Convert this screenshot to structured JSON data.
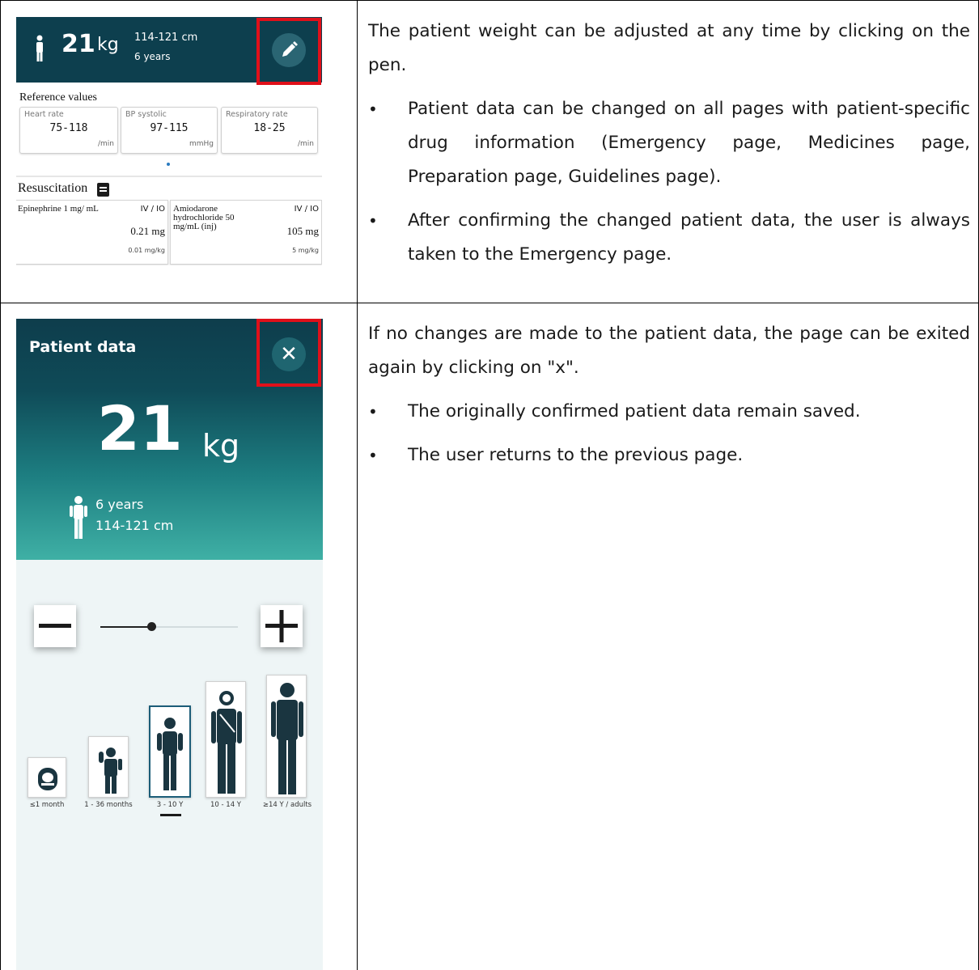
{
  "section1": {
    "screenshot": {
      "weight_value": "21",
      "weight_unit": "kg",
      "height_range": "114-121 cm",
      "age": "6 years",
      "edit_icon": "pencil-icon",
      "reference_title": "Reference values",
      "reference_values": [
        {
          "label": "Heart rate",
          "value": "75-118",
          "unit": "/min"
        },
        {
          "label": "BP systolic",
          "value": "97-115",
          "unit": "mmHg"
        },
        {
          "label": "Respiratory rate",
          "value": "18-25",
          "unit": "/min"
        }
      ],
      "resuscitation_title": "Resuscitation",
      "resuscitation_items": [
        {
          "name": "Epinephrine 1 mg/ mL",
          "route": "IV / IO",
          "dose": "0.21 mg",
          "per_kg": "0.01 mg/kg"
        },
        {
          "name": "Amiodarone hydrochloride 50 mg/mL (inj)",
          "route": "IV / IO",
          "dose": "105 mg",
          "per_kg": "5 mg/kg"
        }
      ]
    },
    "description": "The patient weight can be adjusted at any time by clicking on the pen.",
    "bullets": [
      "Patient data can be changed on all pages with patient-specific drug information (Emergency page, Medicines page, Preparation page, Guidelines page).",
      "After confirming the changed patient data, the user is always taken to the Emergency page."
    ]
  },
  "section2": {
    "screenshot": {
      "title": "Patient data",
      "close_label": "✕",
      "weight_value": "21",
      "weight_unit": "kg",
      "age": "6 years",
      "height_range": "114-121 cm",
      "slider_level_percent": 37,
      "age_groups": [
        {
          "label": "≤1 month",
          "selected": false
        },
        {
          "label": "1 - 36 months",
          "selected": false
        },
        {
          "label": "3 - 10 Y",
          "selected": true
        },
        {
          "label": "10 - 14 Y",
          "selected": false
        },
        {
          "label": "≥14 Y / adults",
          "selected": false
        }
      ]
    },
    "description": "If no changes are made to the patient data, the page can be exited again by clicking on \"x\".",
    "bullets": [
      "The originally confirmed patient data remain saved.",
      "The user returns to the previous page."
    ]
  },
  "colors": {
    "header_dark": "#0d3f4e",
    "highlight_red": "#e0101a",
    "gradient_end": "#3fb0a5"
  }
}
